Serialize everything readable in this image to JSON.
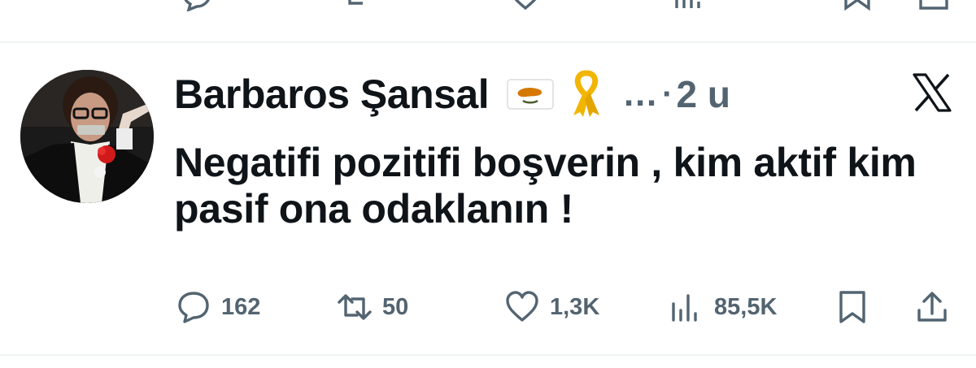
{
  "tweet": {
    "author_name": "Barbaros Şansal",
    "ellipsis": "…",
    "separator": "·",
    "time": "2 u",
    "text": "Negatifi pozitifi boşverin , kim aktif kim pasif ona odaklanın !",
    "badges": [
      "cyprus-flag-icon",
      "yellow-ribbon-icon"
    ],
    "platform_icon": "x-logo-icon",
    "actions": {
      "replies": "162",
      "retweets": "50",
      "likes": "1,3K",
      "views": "85,5K"
    }
  },
  "colors": {
    "text_primary": "#0f1419",
    "text_secondary": "#536471",
    "divider": "#eff3f4",
    "background": "#ffffff"
  }
}
